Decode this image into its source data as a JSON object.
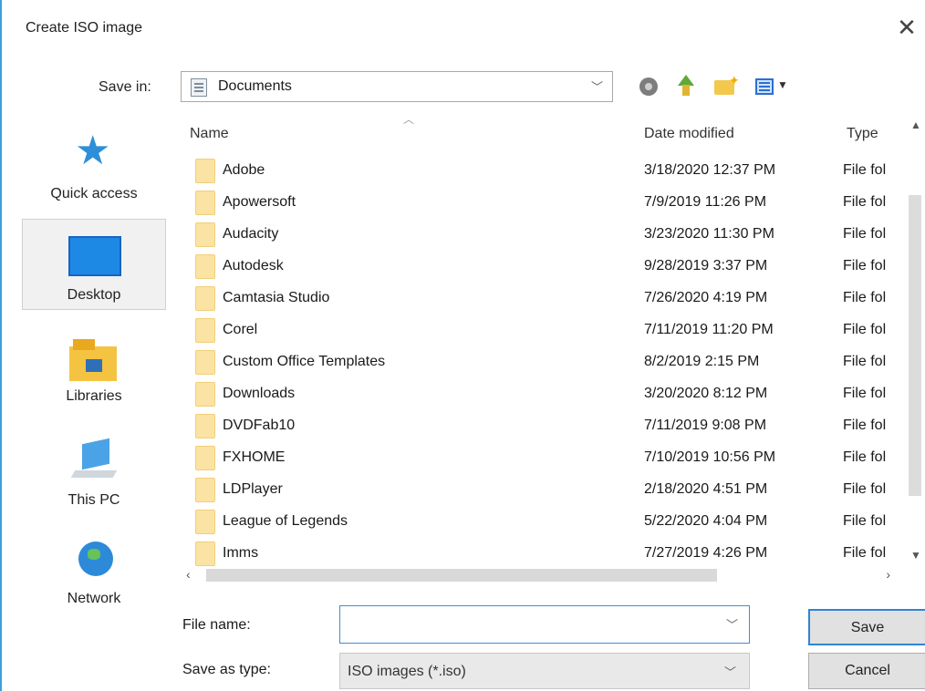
{
  "window": {
    "title": "Create ISO image",
    "close_symbol": "✕"
  },
  "toolbar": {
    "save_in_label": "Save in:",
    "save_in_value": "Documents",
    "icons": [
      "back-icon",
      "up-folder-icon",
      "new-folder-icon",
      "view-menu-icon"
    ]
  },
  "places": [
    {
      "label": "Quick access",
      "icon": "star-icon"
    },
    {
      "label": "Desktop",
      "icon": "desktop-icon",
      "selected": true
    },
    {
      "label": "Libraries",
      "icon": "libraries-icon"
    },
    {
      "label": "This PC",
      "icon": "computer-icon"
    },
    {
      "label": "Network",
      "icon": "network-icon"
    }
  ],
  "columns": {
    "name": "Name",
    "date": "Date modified",
    "type": "Type"
  },
  "files": [
    {
      "name": "Adobe",
      "date": "3/18/2020 12:37 PM",
      "type": "File fol"
    },
    {
      "name": "Apowersoft",
      "date": "7/9/2019 11:26 PM",
      "type": "File fol"
    },
    {
      "name": "Audacity",
      "date": "3/23/2020 11:30 PM",
      "type": "File fol"
    },
    {
      "name": "Autodesk",
      "date": "9/28/2019 3:37 PM",
      "type": "File fol"
    },
    {
      "name": "Camtasia Studio",
      "date": "7/26/2020 4:19 PM",
      "type": "File fol"
    },
    {
      "name": "Corel",
      "date": "7/11/2019 11:20 PM",
      "type": "File fol"
    },
    {
      "name": "Custom Office Templates",
      "date": "8/2/2019 2:15 PM",
      "type": "File fol"
    },
    {
      "name": "Downloads",
      "date": "3/20/2020 8:12 PM",
      "type": "File fol"
    },
    {
      "name": "DVDFab10",
      "date": "7/11/2019 9:08 PM",
      "type": "File fol"
    },
    {
      "name": "FXHOME",
      "date": "7/10/2019 10:56 PM",
      "type": "File fol"
    },
    {
      "name": "LDPlayer",
      "date": "2/18/2020 4:51 PM",
      "type": "File fol"
    },
    {
      "name": "League of Legends",
      "date": "5/22/2020 4:04 PM",
      "type": "File fol"
    },
    {
      "name": "Imms",
      "date": "7/27/2019 4:26 PM",
      "type": "File fol"
    }
  ],
  "footer": {
    "file_name_label": "File name:",
    "file_name_value": "",
    "save_as_type_label": "Save as type:",
    "save_as_type_value": "ISO images (*.iso)",
    "save_button": "Save",
    "cancel_button": "Cancel"
  },
  "colors": {
    "accent": "#2e86d6",
    "folder": "#fbe3a4"
  }
}
